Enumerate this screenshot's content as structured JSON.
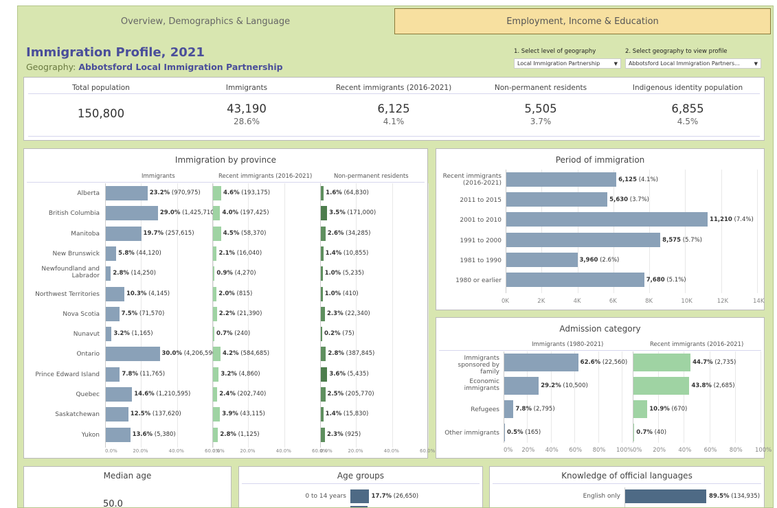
{
  "tabs": {
    "tab1": "Overview, Demographics & Language",
    "tab2": "Employment, Income & Education"
  },
  "header": {
    "title": "Immigration Profile, 2021",
    "geo_label": "Geography:",
    "geo_value": "Abbotsford Local Immigration Partnership"
  },
  "selectors": {
    "level_label": "1. Select level of geography",
    "level_value": "Local Immigration Partnership",
    "geo_label": "2. Select geography to view profile",
    "geo_value": "Abbotsford Local Immigration Partners..."
  },
  "kpis": [
    {
      "label": "Total population",
      "value": "150,800",
      "pct": ""
    },
    {
      "label": "Immigrants",
      "value": "43,190",
      "pct": "28.6%"
    },
    {
      "label": "Recent immigrants (2016-2021)",
      "value": "6,125",
      "pct": "4.1%"
    },
    {
      "label": "Non-permanent residents",
      "value": "5,505",
      "pct": "3.7%"
    },
    {
      "label": "Indigenous identity population",
      "value": "6,855",
      "pct": "4.5%"
    }
  ],
  "province": {
    "title": "Immigration by province",
    "cols": [
      "Immigrants",
      "Recent immigrants (2016-2021)",
      "Non-permanent residents"
    ],
    "axis": [
      "0.0%",
      "20.0%",
      "40.0%",
      "60.0%"
    ],
    "rows": [
      {
        "name": "Alberta",
        "imm": [
          23.2,
          "23.2%",
          "(970,975)"
        ],
        "rec": [
          4.6,
          "4.6%",
          "(193,175)"
        ],
        "npr": [
          1.6,
          "1.6%",
          "(64,830)"
        ]
      },
      {
        "name": "British Columbia",
        "imm": [
          29.0,
          "29.0%",
          "(1,425,710)"
        ],
        "rec": [
          4.0,
          "4.0%",
          "(197,425)"
        ],
        "npr": [
          3.5,
          "3.5%",
          "(171,000)"
        ]
      },
      {
        "name": "Manitoba",
        "imm": [
          19.7,
          "19.7%",
          "(257,615)"
        ],
        "rec": [
          4.5,
          "4.5%",
          "(58,370)"
        ],
        "npr": [
          2.6,
          "2.6%",
          "(34,285)"
        ]
      },
      {
        "name": "New Brunswick",
        "imm": [
          5.8,
          "5.8%",
          "(44,120)"
        ],
        "rec": [
          2.1,
          "2.1%",
          "(16,040)"
        ],
        "npr": [
          1.4,
          "1.4%",
          "(10,855)"
        ]
      },
      {
        "name": "Newfoundland and Labrador",
        "imm": [
          2.8,
          "2.8%",
          "(14,250)"
        ],
        "rec": [
          0.9,
          "0.9%",
          "(4,270)"
        ],
        "npr": [
          1.0,
          "1.0%",
          "(5,235)"
        ]
      },
      {
        "name": "Northwest Territories",
        "imm": [
          10.3,
          "10.3%",
          "(4,145)"
        ],
        "rec": [
          2.0,
          "2.0%",
          "(815)"
        ],
        "npr": [
          1.0,
          "1.0%",
          "(410)"
        ]
      },
      {
        "name": "Nova Scotia",
        "imm": [
          7.5,
          "7.5%",
          "(71,570)"
        ],
        "rec": [
          2.2,
          "2.2%",
          "(21,390)"
        ],
        "npr": [
          2.3,
          "2.3%",
          "(22,340)"
        ]
      },
      {
        "name": "Nunavut",
        "imm": [
          3.2,
          "3.2%",
          "(1,165)"
        ],
        "rec": [
          0.7,
          "0.7%",
          "(240)"
        ],
        "npr": [
          0.2,
          "0.2%",
          "(75)"
        ]
      },
      {
        "name": "Ontario",
        "imm": [
          30.0,
          "30.0%",
          "(4,206,590)"
        ],
        "rec": [
          4.2,
          "4.2%",
          "(584,685)"
        ],
        "npr": [
          2.8,
          "2.8%",
          "(387,845)"
        ]
      },
      {
        "name": "Prince Edward Island",
        "imm": [
          7.8,
          "7.8%",
          "(11,765)"
        ],
        "rec": [
          3.2,
          "3.2%",
          "(4,860)"
        ],
        "npr": [
          3.6,
          "3.6%",
          "(5,435)"
        ]
      },
      {
        "name": "Quebec",
        "imm": [
          14.6,
          "14.6%",
          "(1,210,595)"
        ],
        "rec": [
          2.4,
          "2.4%",
          "(202,740)"
        ],
        "npr": [
          2.5,
          "2.5%",
          "(205,770)"
        ]
      },
      {
        "name": "Saskatchewan",
        "imm": [
          12.5,
          "12.5%",
          "(137,620)"
        ],
        "rec": [
          3.9,
          "3.9%",
          "(43,115)"
        ],
        "npr": [
          1.4,
          "1.4%",
          "(15,830)"
        ]
      },
      {
        "name": "Yukon",
        "imm": [
          13.6,
          "13.6%",
          "(5,380)"
        ],
        "rec": [
          2.8,
          "2.8%",
          "(1,125)"
        ],
        "npr": [
          2.3,
          "2.3%",
          "(925)"
        ]
      }
    ]
  },
  "period": {
    "title": "Period of immigration",
    "axis": [
      "0K",
      "2K",
      "4K",
      "6K",
      "8K",
      "10K",
      "12K",
      "14K"
    ],
    "rows": [
      {
        "name": "Recent immigrants (2016-2021)",
        "value": 6125,
        "label": "6,125",
        "pct": "(4.1%)"
      },
      {
        "name": "2011 to 2015",
        "value": 5630,
        "label": "5,630",
        "pct": "(3.7%)"
      },
      {
        "name": "2001 to 2010",
        "value": 11210,
        "label": "11,210",
        "pct": "(7.4%)"
      },
      {
        "name": "1991 to 2000",
        "value": 8575,
        "label": "8,575",
        "pct": "(5.7%)"
      },
      {
        "name": "1981 to 1990",
        "value": 3960,
        "label": "3,960",
        "pct": "(2.6%)"
      },
      {
        "name": "1980 or earlier",
        "value": 7680,
        "label": "7,680",
        "pct": "(5.1%)"
      }
    ]
  },
  "admission": {
    "title": "Admission category",
    "cols": [
      "Immigrants (1980-2021)",
      "Recent immigrants (2016-2021)"
    ],
    "axis": [
      "0%",
      "20%",
      "40%",
      "60%",
      "80%",
      "100%"
    ],
    "rows": [
      {
        "name": "Immigrants sponsored by family",
        "imm": [
          62.6,
          "62.6%",
          "(22,560)"
        ],
        "rec": [
          44.7,
          "44.7%",
          "(2,735)"
        ]
      },
      {
        "name": "Economic immigrants",
        "imm": [
          29.2,
          "29.2%",
          "(10,500)"
        ],
        "rec": [
          43.8,
          "43.8%",
          "(2,685)"
        ]
      },
      {
        "name": "Refugees",
        "imm": [
          7.8,
          "7.8%",
          "(2,795)"
        ],
        "rec": [
          10.9,
          "10.9%",
          "(670)"
        ]
      },
      {
        "name": "Other immigrants",
        "imm": [
          0.5,
          "0.5%",
          "(165)"
        ],
        "rec": [
          0.7,
          "0.7%",
          "(40)"
        ]
      }
    ]
  },
  "median": {
    "title": "Median age",
    "value": "50.0"
  },
  "age": {
    "title": "Age groups",
    "rows": [
      {
        "name": "0 to 14 years",
        "value": 17.7,
        "label": "17.7%",
        "count": "(26,650)"
      }
    ]
  },
  "lang": {
    "title": "Knowledge of official languages",
    "rows": [
      {
        "name": "English only",
        "value": 89.5,
        "label": "89.5%",
        "count": "(134,935)"
      }
    ]
  },
  "colors": {
    "imm": "#8aa1b8",
    "rec": "#9fd3a3",
    "npr": "#5e8f5e",
    "nprDark": "#4d7d4d",
    "langBar": "#4e6a85"
  }
}
